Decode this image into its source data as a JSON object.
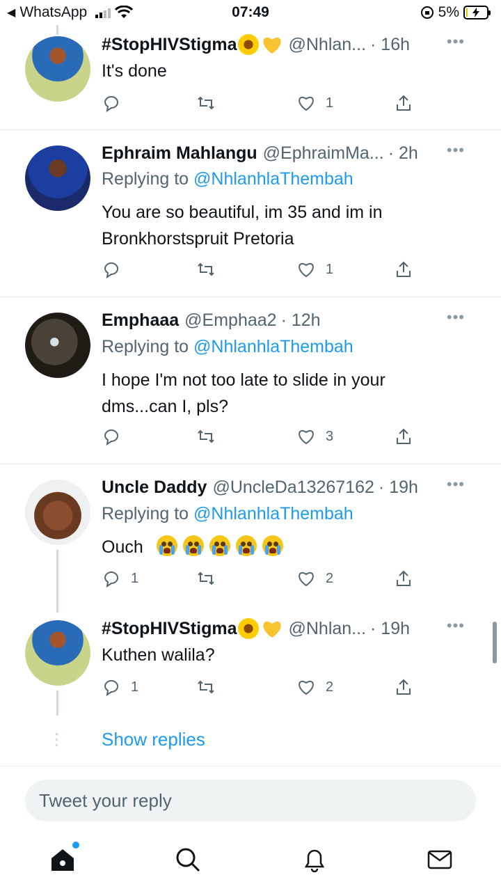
{
  "status_bar": {
    "back_app": "WhatsApp",
    "time": "07:49",
    "battery": "5%"
  },
  "tweets": [
    {
      "name": "#StopHIVStigma",
      "name_emoji": [
        "sunflower",
        "yellow-heart"
      ],
      "handle": "@Nhlan...",
      "time": "· 16h",
      "replying_prefix": "",
      "replying_to": "",
      "body": "It's done",
      "replies": "",
      "likes": "1"
    },
    {
      "name": "Ephraim Mahlangu",
      "handle": "@EphraimMa...",
      "time": "· 2h",
      "replying_prefix": "Replying to ",
      "replying_to": "@NhlanhlaThembah",
      "body_lines": [
        "You are so beautiful, im 35  and im in",
        "Bronkhorstspruit Pretoria"
      ],
      "replies": "",
      "likes": "1"
    },
    {
      "name": "Emphaaa",
      "handle": "@Emphaa2",
      "time": "· 12h",
      "replying_prefix": "Replying to ",
      "replying_to": "@NhlanhlaThembah",
      "body_lines": [
        "I hope I'm not too late to slide in your",
        "dms...can I, pls?"
      ],
      "replies": "",
      "likes": "3"
    },
    {
      "name": "Uncle Daddy",
      "handle": "@UncleDa13267162",
      "time": "· 19h",
      "replying_prefix": "Replying to ",
      "replying_to": "@NhlanhlaThembah",
      "body": "Ouch",
      "body_emoji_count": 5,
      "body_emoji": "loudly-crying-face",
      "replies": "1",
      "likes": "2"
    },
    {
      "name": "#StopHIVStigma",
      "name_emoji": [
        "sunflower",
        "yellow-heart"
      ],
      "handle": "@Nhlan...",
      "time": "· 19h",
      "body": "Kuthen walila?",
      "replies": "1",
      "likes": "2"
    }
  ],
  "show_replies": "Show replies",
  "reply_box": {
    "placeholder": "Tweet your reply"
  },
  "tabbar": {
    "icons": [
      "home-icon",
      "search-icon",
      "notifications-icon",
      "messages-icon"
    ]
  },
  "colors": {
    "accent": "#1d9bf0",
    "muted": "#536471",
    "divider": "#e6ecf0"
  }
}
